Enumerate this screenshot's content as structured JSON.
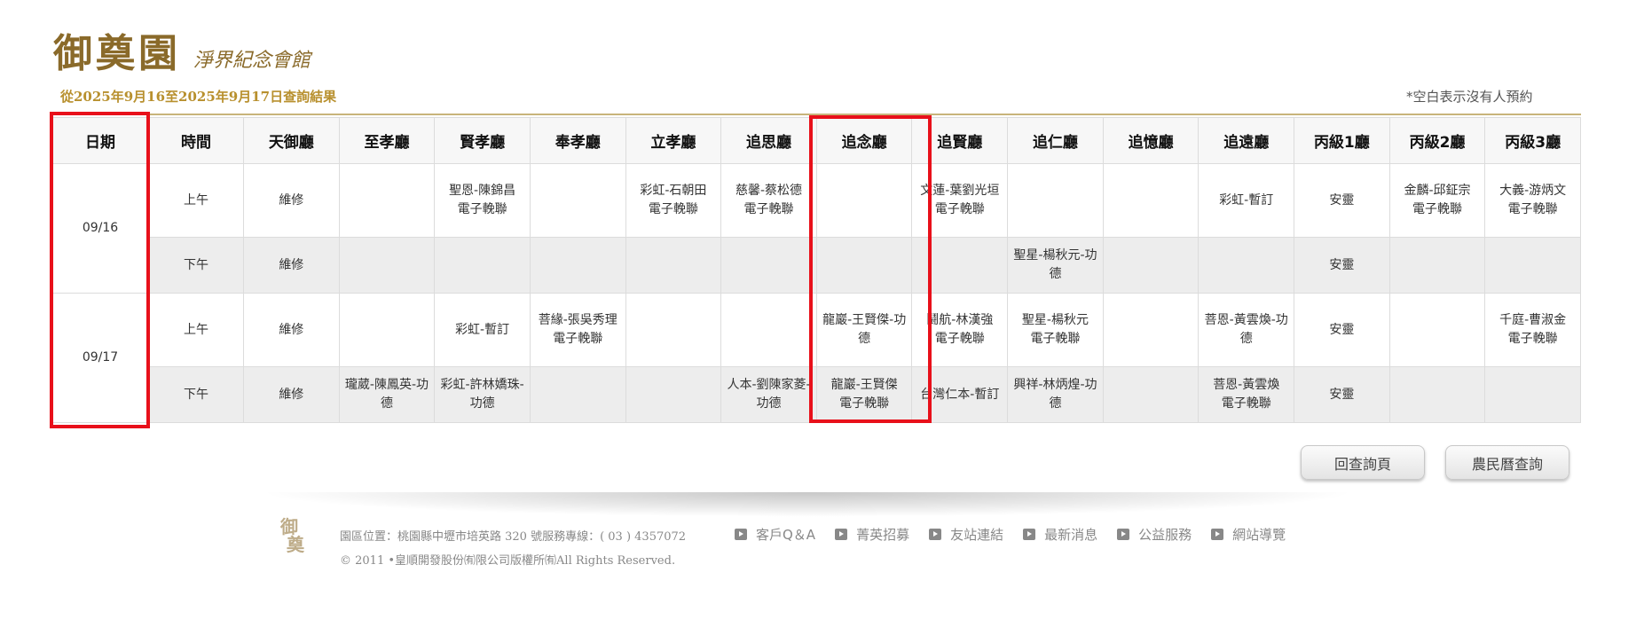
{
  "brand": {
    "name": "御奠園",
    "subtitle": "淨界紀念會館"
  },
  "query_range": "從2025年9月16至2025年9月17日查詢結果",
  "note": "*空白表示沒有人預約",
  "columns": [
    "日期",
    "時間",
    "天御廳",
    "至孝廳",
    "賢孝廳",
    "奉孝廳",
    "立孝廳",
    "追思廳",
    "追念廳",
    "追賢廳",
    "追仁廳",
    "追憶廳",
    "追遠廳",
    "丙級1廳",
    "丙級2廳",
    "丙級3廳"
  ],
  "days": [
    {
      "date": "09/16",
      "slots": [
        {
          "time": "上午",
          "cells": [
            "維修",
            "",
            "聖恩-陳錦昌\n電子輓聯",
            "",
            "彩虹-石朝田\n電子輓聯",
            "慈馨-蔡松德\n電子輓聯",
            "",
            "文蓮-葉劉光垣\n電子輓聯",
            "",
            "",
            "彩虹-暫訂",
            "安靈",
            "金麟-邱鉦宗\n電子輓聯",
            "大義-游炳文\n電子輓聯"
          ]
        },
        {
          "time": "下午",
          "cells": [
            "維修",
            "",
            "",
            "",
            "",
            "",
            "",
            "",
            "聖星-楊秋元-功德",
            "",
            "",
            "安靈",
            "",
            ""
          ]
        }
      ]
    },
    {
      "date": "09/17",
      "slots": [
        {
          "time": "上午",
          "cells": [
            "維修",
            "",
            "彩虹-暫訂",
            "菩緣-張吳秀理\n電子輓聯",
            "",
            "",
            "龍巖-王賢傑-功德",
            "鬪航-林漢強\n電子輓聯",
            "聖星-楊秋元\n電子輓聯",
            "",
            "菩恩-黃雲煥-功德",
            "安靈",
            "",
            "千庭-曹淑金\n電子輓聯"
          ]
        },
        {
          "time": "下午",
          "cells": [
            "維修",
            "瓏葳-陳鳳英-功德",
            "彩虹-許林嬌珠-功德",
            "",
            "",
            "人本-劉陳家菱-功德",
            "龍巖-王賢傑\n電子輓聯",
            "台灣仁本-暫訂",
            "興祥-林炳煌-功德",
            "",
            "菩恩-黃雲煥\n電子輓聯",
            "安靈",
            "",
            ""
          ]
        }
      ]
    }
  ],
  "buttons": {
    "back": "回查詢頁",
    "calendar": "農民曆查詢"
  },
  "footer": {
    "address": "園區位置：桃園縣中壢市培英路 320 號服務專線：( 03 ) 4357072",
    "copyright": "© 2011 •皇順開發股份㈲限公司版權所㈲All Rights Reserved.",
    "links": [
      "客戶Q＆A",
      "菁英招募",
      "友站連結",
      "最新消息",
      "公益服務",
      "網站導覽"
    ]
  },
  "colors": {
    "highlight": "#e8101a",
    "gold": "#b8902e",
    "brand": "#8a6a2a"
  }
}
